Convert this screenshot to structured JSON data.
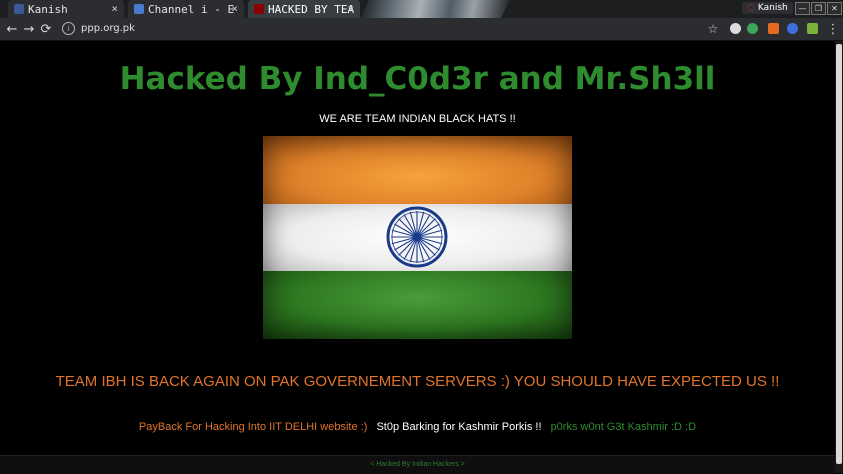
{
  "browser": {
    "tabs": [
      {
        "title": "Kanish",
        "close": "×",
        "favicon_color": "#3b5998"
      },
      {
        "title": "Channel i - E",
        "close": "×",
        "favicon_color": "#4a7bd0"
      },
      {
        "title": "HACKED BY TEA",
        "close": "×",
        "favicon_color": "#8b0000"
      }
    ],
    "profile_name": "Kanish",
    "window_controls": {
      "minimize": "—",
      "restore": "❐",
      "close": "✕"
    },
    "nav": {
      "back": "←",
      "forward": "→",
      "reload": "⟳"
    },
    "address": "ppp.org.pk",
    "star": "☆",
    "menu": "⋮"
  },
  "page": {
    "headline": "Hacked By Ind_C0d3r and Mr.Sh3ll",
    "subheadline": "WE ARE TEAM INDIAN BLACK HATS !!",
    "tagline": "TEAM IBH IS BACK AGAIN ON PAK GOVERNEMENT SERVERS :) YOU SHOULD HAVE EXPECTED US !!",
    "footer_segments": {
      "orange": "PayBack For Hacking Into IIT DELHI website :)",
      "white": "St0p Barking for Kashmir Porkis !!",
      "green": "p0rks w0nt G3t Kashmir :D :D"
    },
    "bottom_bar": "< Hacked By Indian Hackers >",
    "colors": {
      "green_text": "#2e8b2e",
      "orange_text": "#e0742a",
      "saffron": "#e0822a",
      "flag_green": "#2f7a22",
      "chakra_blue": "#1a3a8a"
    }
  }
}
